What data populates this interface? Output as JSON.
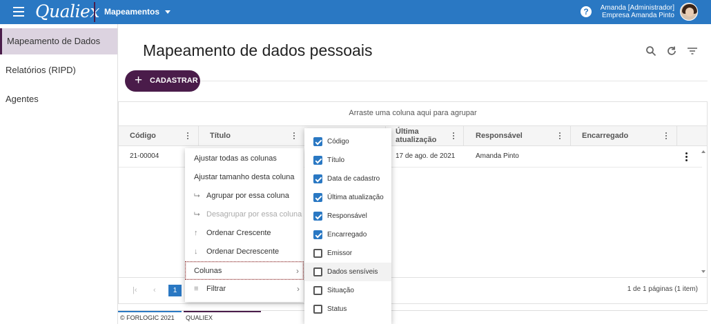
{
  "topbar": {
    "logo": "Qualiex",
    "module": "Mapeamentos",
    "help_glyph": "?",
    "user_name": "Amanda [Administrador]",
    "user_company": "Empresa Amanda Pinto"
  },
  "sidebar": {
    "items": [
      {
        "label": "Mapeamento de Dados",
        "active": true
      },
      {
        "label": "Relatórios (RIPD)",
        "active": false
      },
      {
        "label": "Agentes",
        "active": false
      }
    ]
  },
  "main": {
    "title": "Mapeamento de dados pessoais",
    "toolbar_icons": [
      "search-icon",
      "refresh-icon",
      "filter-icon"
    ],
    "add_button": {
      "icon": "+",
      "label": "CADASTRAR"
    }
  },
  "grid": {
    "group_hint": "Arraste uma coluna aqui para agrupar",
    "columns": [
      "Código",
      "Título",
      "Última atualização",
      "Responsável",
      "Encarregado"
    ],
    "rows": [
      {
        "codigo": "21-00004",
        "atualizacao": "17 de ago. de 2021",
        "responsavel": "Amanda Pinto"
      }
    ],
    "pager": {
      "first": "|‹",
      "prev": "‹",
      "current_page": "1",
      "info": "1 de 1 páginas (1 item)"
    }
  },
  "footer": {
    "copyright": "© FORLOGIC 2021",
    "brand": "QUALIEX",
    "accent_blue": "#2a78c3",
    "accent_purple": "#4a1c4a"
  },
  "context_menu": {
    "items": [
      {
        "label": "Ajustar todas as colunas",
        "icon": "",
        "disabled": false
      },
      {
        "label": "Ajustar tamanho desta coluna",
        "icon": "",
        "disabled": false
      },
      {
        "label": "Agrupar por essa coluna",
        "icon": "group-icon",
        "glyph": "⮡",
        "disabled": false
      },
      {
        "label": "Desagrupar por essa coluna",
        "icon": "ungroup-icon",
        "glyph": "⮡",
        "disabled": true
      },
      {
        "label": "Ordenar Crescente",
        "icon": "arrow-up-icon",
        "glyph": "↑",
        "disabled": false
      },
      {
        "label": "Ordenar Decrescente",
        "icon": "arrow-down-icon",
        "glyph": "↓",
        "disabled": false
      },
      {
        "label": "Colunas",
        "icon": "",
        "disabled": false,
        "submenu": true,
        "highlighted": true
      },
      {
        "label": "Filtrar",
        "icon": "filter-icon",
        "glyph": "≡",
        "disabled": false,
        "submenu": true
      }
    ],
    "chevron": "›"
  },
  "column_menu": {
    "items": [
      {
        "label": "Código",
        "checked": true
      },
      {
        "label": "Título",
        "checked": true
      },
      {
        "label": "Data de cadastro",
        "checked": true
      },
      {
        "label": "Última atualização",
        "checked": true
      },
      {
        "label": "Responsável",
        "checked": true
      },
      {
        "label": "Encarregado",
        "checked": true
      },
      {
        "label": "Emissor",
        "checked": false
      },
      {
        "label": "Dados sensíveis",
        "checked": false,
        "hover": true
      },
      {
        "label": "Situação",
        "checked": false
      },
      {
        "label": "Status",
        "checked": false
      }
    ]
  }
}
